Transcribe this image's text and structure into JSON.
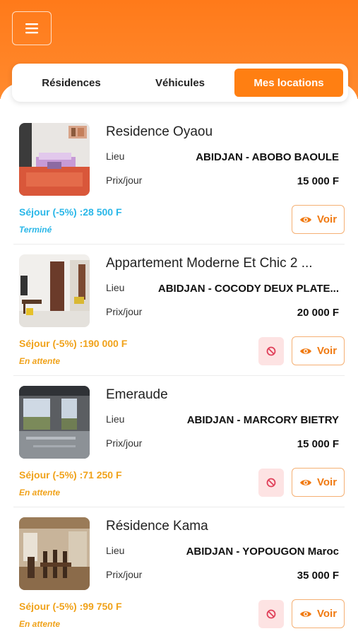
{
  "header": {
    "menu_icon": "hamburger-menu-icon"
  },
  "tabs": [
    {
      "label": "Résidences",
      "active": false
    },
    {
      "label": "Véhicules",
      "active": false
    },
    {
      "label": "Mes locations",
      "active": true
    }
  ],
  "colors": {
    "accent": "#ff7f12",
    "status_done": "#2ab7e8",
    "status_pending": "#f0a21a",
    "cancel_bg": "#fde3e3",
    "cancel_icon": "#e0405a"
  },
  "labels": {
    "lieu": "Lieu",
    "prix_jour": "Prix/jour",
    "voir": "Voir"
  },
  "bookings": [
    {
      "title": "Residence Oyaou",
      "lieu": "ABIDJAN - ABOBO BAOULE",
      "prix": "15 000 F",
      "sejour": "Séjour (-5%) :28 500 F",
      "status": "Terminé",
      "status_kind": "done",
      "cancellable": false
    },
    {
      "title": "Appartement Moderne Et Chic 2 ...",
      "lieu": "ABIDJAN - COCODY DEUX PLATE...",
      "prix": "20 000 F",
      "sejour": "Séjour (-5%) :190 000 F",
      "status": "En attente",
      "status_kind": "pending",
      "cancellable": true
    },
    {
      "title": "Emeraude",
      "lieu": "ABIDJAN - MARCORY BIETRY",
      "prix": "15 000 F",
      "sejour": "Séjour (-5%) :71 250 F",
      "status": "En attente",
      "status_kind": "pending",
      "cancellable": true
    },
    {
      "title": "Résidence Kama",
      "lieu": "ABIDJAN - YOPOUGON Maroc",
      "prix": "35 000 F",
      "sejour": "Séjour (-5%) :99 750 F",
      "status": "En attente",
      "status_kind": "pending",
      "cancellable": true
    }
  ]
}
